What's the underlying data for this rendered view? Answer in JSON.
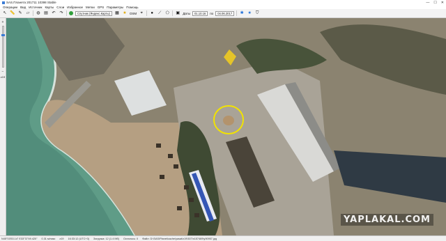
{
  "window": {
    "title": "SAS.Планета 201711 10398 Stable",
    "controls": [
      "—",
      "☐",
      "✕"
    ]
  },
  "menu": [
    "Операции",
    "Вид",
    "Источник",
    "Карты",
    "Слои",
    "Избранное",
    "Метки",
    "GPS",
    "Параметры",
    "Помощь"
  ],
  "toolbar": {
    "map_combo": "Спутник (Яндекс.Карты)",
    "layer_label": "OSM",
    "date_label": "Даты",
    "date_from": "01.10.16",
    "date_to_label": "по",
    "date_to": "04.06.2017"
  },
  "sidebar": {
    "zoom_label": "z19",
    "zoom_fraction": 0.8
  },
  "map": {
    "watermark": "YAPLAKAL.COM",
    "colors": {
      "sea": "#5f9c87",
      "sand": "#b59f82",
      "circle": "#f2e300",
      "foliage": "#3f4a33"
    }
  },
  "status": {
    "coords": "N45°03'53.14\" E33°37'49.420\"",
    "scale": "0.31 м/пикс",
    "zoom": "z19",
    "time": "16:33:12 (UTC+3)",
    "status_time": "Загрузка: 12 (1.4 Мб)",
    "cache": "Осталось: 0",
    "file": "Файл: D:\\SAS\\Planet\\cache\\yasat\\z19\\307\\x157469\\y90957.jpg"
  }
}
